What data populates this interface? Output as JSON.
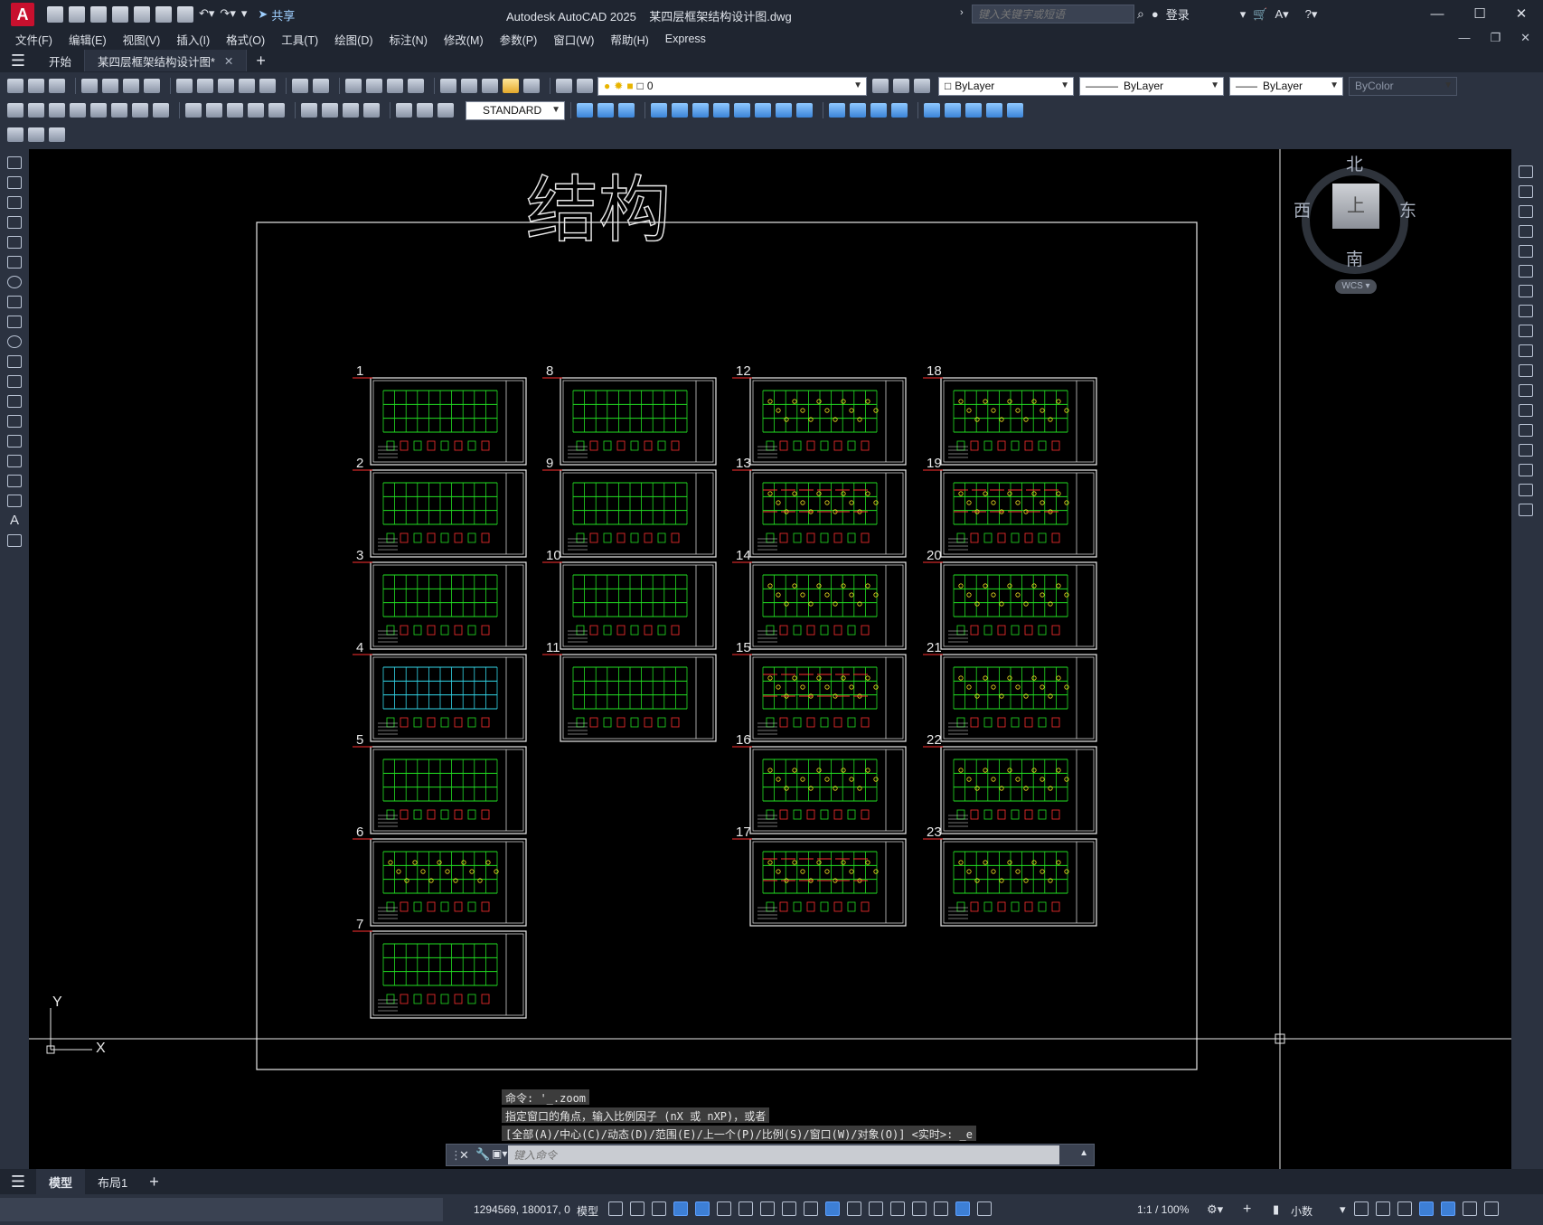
{
  "app": {
    "title": "Autodesk AutoCAD 2025    某四层框架结构设计图.dwg",
    "search_placeholder": "键入关键字或短语",
    "login": "登录",
    "share": "共享"
  },
  "menu": [
    "文件(F)",
    "编辑(E)",
    "视图(V)",
    "插入(I)",
    "格式(O)",
    "工具(T)",
    "绘图(D)",
    "标注(N)",
    "修改(M)",
    "参数(P)",
    "窗口(W)",
    "帮助(H)",
    "Express"
  ],
  "file_tabs": {
    "start": "开始",
    "active": "某四层框架结构设计图*"
  },
  "toolbar": {
    "layer_value": "0",
    "text_style": "STANDARD",
    "color": "ByLayer",
    "linetype": "ByLayer",
    "lineweight": "ByLayer",
    "plotstyle": "ByColor"
  },
  "drawing": {
    "heading": "结构",
    "sheet_numbers": [
      "1",
      "2",
      "3",
      "4",
      "5",
      "6",
      "7",
      "8",
      "9",
      "10",
      "11",
      "12",
      "13",
      "14",
      "15",
      "16",
      "17",
      "18",
      "19",
      "20",
      "21",
      "22",
      "23"
    ]
  },
  "viewcube": {
    "north": "北",
    "south": "南",
    "east": "东",
    "west": "西",
    "top": "上",
    "wcs": "WCS"
  },
  "ucs": {
    "x": "X",
    "y": "Y"
  },
  "command": {
    "history": [
      "命令: '_.zoom",
      "指定窗口的角点，输入比例因子 (nX 或 nXP)，或者",
      "[全部(A)/中心(C)/动态(D)/范围(E)/上一个(P)/比例(S)/窗口(W)/对象(O)] <实时>: _e"
    ],
    "placeholder": "键入命令"
  },
  "layout_tabs": [
    "模型",
    "布局1"
  ],
  "status": {
    "coords": "1294569, 180017, 0",
    "model": "模型",
    "scale": "1:1 / 100%",
    "units": "小数"
  }
}
